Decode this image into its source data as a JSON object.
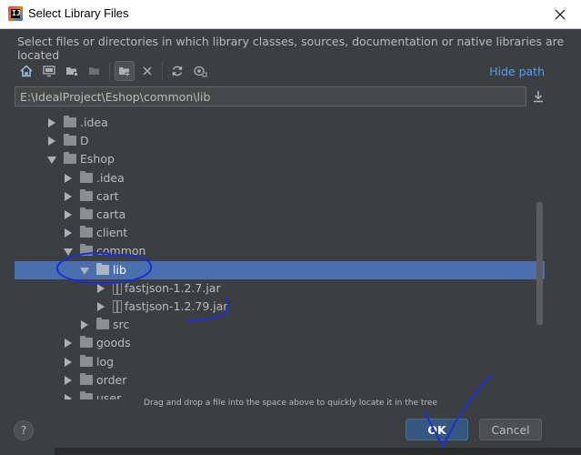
{
  "window": {
    "title": "Select Library Files"
  },
  "dialog": {
    "description": "Select files or directories in which library classes, sources, documentation or native libraries are located",
    "hide_path_label": "Hide path",
    "path_value": "E:\\IdealProject\\Eshop\\common\\lib",
    "drag_hint": "Drag and drop a file into the space above to quickly locate it in the tree",
    "ok_label": "OK",
    "cancel_label": "Cancel",
    "help_label": "?"
  },
  "toolbar": {
    "icons": [
      "home-icon",
      "desktop-icon",
      "project-folder-icon",
      "module-folder-icon",
      "new-folder-icon",
      "delete-icon",
      "refresh-icon",
      "show-hidden-icon"
    ]
  },
  "tree": {
    "items": [
      {
        "label": ".idea",
        "depth": 1,
        "state": "collapsed",
        "type": "folder"
      },
      {
        "label": "D",
        "depth": 1,
        "state": "collapsed",
        "type": "folder"
      },
      {
        "label": "Eshop",
        "depth": 1,
        "state": "expanded",
        "type": "folder"
      },
      {
        "label": ".idea",
        "depth": 2,
        "state": "collapsed",
        "type": "folder"
      },
      {
        "label": "cart",
        "depth": 2,
        "state": "collapsed",
        "type": "folder"
      },
      {
        "label": "carta",
        "depth": 2,
        "state": "collapsed",
        "type": "folder"
      },
      {
        "label": "client",
        "depth": 2,
        "state": "collapsed",
        "type": "folder"
      },
      {
        "label": "common",
        "depth": 2,
        "state": "expanded",
        "type": "folder"
      },
      {
        "label": "lib",
        "depth": 3,
        "state": "expanded",
        "type": "folder",
        "selected": true
      },
      {
        "label": "fastjson-1.2.7.jar",
        "depth": 4,
        "state": "collapsed",
        "type": "jar"
      },
      {
        "label": "fastjson-1.2.79.jar",
        "depth": 4,
        "state": "collapsed",
        "type": "jar"
      },
      {
        "label": "src",
        "depth": 3,
        "state": "collapsed",
        "type": "folder"
      },
      {
        "label": "goods",
        "depth": 2,
        "state": "collapsed",
        "type": "folder"
      },
      {
        "label": "log",
        "depth": 2,
        "state": "collapsed",
        "type": "folder"
      },
      {
        "label": "order",
        "depth": 2,
        "state": "collapsed",
        "type": "folder"
      },
      {
        "label": "user",
        "depth": 2,
        "state": "collapsed",
        "type": "folder"
      }
    ]
  },
  "colors": {
    "background": "#3c3f41",
    "selection": "#4b6eaf",
    "link": "#589df6",
    "ok_button": "#365880",
    "annotation_ink": "#1a2fd6"
  }
}
